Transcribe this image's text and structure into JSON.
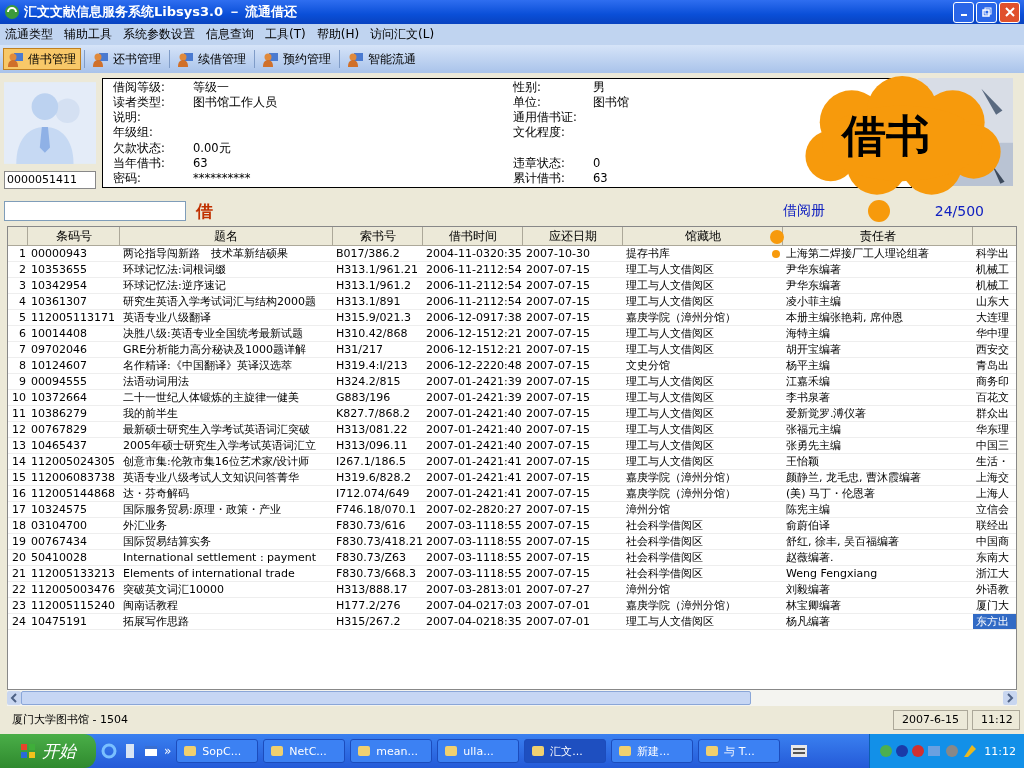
{
  "window": {
    "title": "汇文文献信息服务系统Libsys3.0 － 流通借还"
  },
  "menu": [
    "流通类型",
    "辅助工具",
    "系统参数设置",
    "信息查询",
    "工具(T)",
    "帮助(H)",
    "访问汇文(L)"
  ],
  "toolbar": {
    "items": [
      {
        "label": "借书管理",
        "selected": true
      },
      {
        "label": "还书管理",
        "selected": false
      },
      {
        "label": "续借管理",
        "selected": false
      },
      {
        "label": "预约管理",
        "selected": false
      },
      {
        "label": "智能流通",
        "selected": false
      }
    ]
  },
  "reader": {
    "card_number": "0000051411",
    "left_fields": [
      {
        "label": "借阅等级:",
        "value": "等级一"
      },
      {
        "label": "读者类型:",
        "value": "图书馆工作人员"
      },
      {
        "label": "说明:"
      },
      {
        "label": "年级组:"
      },
      {
        "label": "欠款状态:",
        "value": "0.00元"
      },
      {
        "label": "当年借书:",
        "value": "63"
      },
      {
        "label": "密码:",
        "value": "**********"
      }
    ],
    "right_fields": [
      {
        "label": "性别:",
        "value": "男"
      },
      {
        "label": "单位:",
        "value": "图书馆"
      },
      {
        "label": "通用借书证:"
      },
      {
        "label": "文化程度:"
      },
      {
        "label": "违章状态:",
        "value": "0"
      },
      {
        "label": "累计借书:",
        "value": "63"
      }
    ]
  },
  "borrow_bar": {
    "mode_mark": "借",
    "count_label": "借阅册",
    "count_value": "24/500"
  },
  "callout": {
    "text": "借书"
  },
  "table": {
    "columns": [
      "条码号",
      "题名",
      "索书号",
      "借书时间",
      "应还日期",
      "馆藏地",
      "责任者"
    ],
    "rows": [
      {
        "no": "1",
        "barcode": "00000943",
        "title": "两论指导闯新路　技术革新结硕果",
        "call_no": "B017/386.2",
        "borrowed": "2004-11-0320:35",
        "due": "2007-10-30",
        "location": "提存书库",
        "author": "上海第二焊接厂工人理论组著",
        "publisher": "科学出",
        "selected": false
      },
      {
        "no": "2",
        "barcode": "10353655",
        "title": "环球记忆法:词根词缀",
        "call_no": "H313.1/961.21",
        "borrowed": "2006-11-2112:54",
        "due": "2007-07-15",
        "location": "理工与人文借阅区",
        "author": "尹华东编著",
        "publisher": "机械工",
        "selected": false
      },
      {
        "no": "3",
        "barcode": "10342954",
        "title": "环球记忆法:逆序速记",
        "call_no": "H313.1/961.2",
        "borrowed": "2006-11-2112:54",
        "due": "2007-07-15",
        "location": "理工与人文借阅区",
        "author": "尹华东编著",
        "publisher": "机械工",
        "selected": false
      },
      {
        "no": "4",
        "barcode": "10361307",
        "title": "研究生英语入学考试词汇与结构2000题",
        "call_no": "H313.1/891",
        "borrowed": "2006-11-2112:54",
        "due": "2007-07-15",
        "location": "理工与人文借阅区",
        "author": "凌小菲主编",
        "publisher": "山东大",
        "selected": false
      },
      {
        "no": "5",
        "barcode": "112005113171",
        "title": "英语专业八级翻译",
        "call_no": "H315.9/021.3",
        "borrowed": "2006-12-0917:38",
        "due": "2007-07-15",
        "location": "嘉庚学院（漳州分馆）",
        "author": "本册主编张艳莉, 席仲恩",
        "publisher": "大连理",
        "selected": false
      },
      {
        "no": "6",
        "barcode": "10014408",
        "title": "决胜八级:英语专业全国统考最新试题",
        "call_no": "H310.42/868",
        "borrowed": "2006-12-1512:21",
        "due": "2007-07-15",
        "location": "理工与人文借阅区",
        "author": "海特主编",
        "publisher": "华中理",
        "selected": false
      },
      {
        "no": "7",
        "barcode": "09702046",
        "title": "GRE分析能力高分秘诀及1000题详解",
        "call_no": "H31/217",
        "borrowed": "2006-12-1512:21",
        "due": "2007-07-15",
        "location": "理工与人文借阅区",
        "author": "胡开宝编著",
        "publisher": "西安交",
        "selected": false
      },
      {
        "no": "8",
        "barcode": "10124607",
        "title": "名作精译:《中国翻译》英译汉选萃",
        "call_no": "H319.4:I/213",
        "borrowed": "2006-12-2220:48",
        "due": "2007-07-15",
        "location": "文史分馆",
        "author": "杨平主编",
        "publisher": "青岛出",
        "selected": false
      },
      {
        "no": "9",
        "barcode": "00094555",
        "title": "法语动词用法",
        "call_no": "H324.2/815",
        "borrowed": "2007-01-2421:39",
        "due": "2007-07-15",
        "location": "理工与人文借阅区",
        "author": "江嘉禾编",
        "publisher": "商务印",
        "selected": false
      },
      {
        "no": "10",
        "barcode": "10372664",
        "title": "二十一世纪人体锻炼的主旋律一健美",
        "call_no": "G883/196",
        "borrowed": "2007-01-2421:39",
        "due": "2007-07-15",
        "location": "理工与人文借阅区",
        "author": "李书泉著",
        "publisher": "百花文",
        "selected": false
      },
      {
        "no": "11",
        "barcode": "10386279",
        "title": "我的前半生",
        "call_no": "K827.7/868.2",
        "borrowed": "2007-01-2421:40",
        "due": "2007-07-15",
        "location": "理工与人文借阅区",
        "author": "爱新觉罗.溥仪著",
        "publisher": "群众出",
        "selected": false
      },
      {
        "no": "12",
        "barcode": "00767829",
        "title": "最新硕士研究生入学考试英语词汇突破",
        "call_no": "H313/081.22",
        "borrowed": "2007-01-2421:40",
        "due": "2007-07-15",
        "location": "理工与人文借阅区",
        "author": "张福元主编",
        "publisher": "华东理",
        "selected": false
      },
      {
        "no": "13",
        "barcode": "10465437",
        "title": "2005年硕士研究生入学考试英语词汇立",
        "call_no": "H313/096.11",
        "borrowed": "2007-01-2421:40",
        "due": "2007-07-15",
        "location": "理工与人文借阅区",
        "author": "张勇先主编",
        "publisher": "中国三",
        "selected": false
      },
      {
        "no": "14",
        "barcode": "112005024305",
        "title": "创意市集:伦敦市集16位艺术家/设计师",
        "call_no": "I267.1/186.5",
        "borrowed": "2007-01-2421:41",
        "due": "2007-07-15",
        "location": "理工与人文借阅区",
        "author": "王怡颖",
        "publisher": "生活・",
        "selected": false
      },
      {
        "no": "15",
        "barcode": "112006083738",
        "title": "英语专业八级考试人文知识问答菁华",
        "call_no": "H319.6/828.2",
        "borrowed": "2007-01-2421:41",
        "due": "2007-07-15",
        "location": "嘉庚学院（漳州分馆）",
        "author": "颜静兰, 龙毛忠, 曹沐霞编著",
        "publisher": "上海交",
        "selected": false
      },
      {
        "no": "16",
        "barcode": "112005144868",
        "title": "达・芬奇解码",
        "call_no": "I712.074/649",
        "borrowed": "2007-01-2421:41",
        "due": "2007-07-15",
        "location": "嘉庚学院（漳州分馆）",
        "author": "(美) 马丁・伦恩著",
        "publisher": "上海人",
        "selected": false
      },
      {
        "no": "17",
        "barcode": "10324575",
        "title": "国际服务贸易:原理・政策・产业",
        "call_no": "F746.18/070.1",
        "borrowed": "2007-02-2820:27",
        "due": "2007-07-15",
        "location": "漳州分馆",
        "author": "陈宪主编",
        "publisher": "立信会",
        "selected": false
      },
      {
        "no": "18",
        "barcode": "03104700",
        "title": "外汇业务",
        "call_no": "F830.73/616",
        "borrowed": "2007-03-1118:55",
        "due": "2007-07-15",
        "location": "社会科学借阅区",
        "author": "俞蔚伯译",
        "publisher": "联经出",
        "selected": false
      },
      {
        "no": "19",
        "barcode": "00767434",
        "title": "国际贸易结算实务",
        "call_no": "F830.73/418.21",
        "borrowed": "2007-03-1118:55",
        "due": "2007-07-15",
        "location": "社会科学借阅区",
        "author": "舒红, 徐丰, 吴百福编著",
        "publisher": "中国商",
        "selected": false
      },
      {
        "no": "20",
        "barcode": "50410028",
        "title": "International settlement : payment",
        "call_no": "F830.73/Z63",
        "borrowed": "2007-03-1118:55",
        "due": "2007-07-15",
        "location": "社会科学借阅区",
        "author": "赵薇编著.",
        "publisher": "东南大",
        "selected": false
      },
      {
        "no": "21",
        "barcode": "112005133213",
        "title": "Elements of international trade",
        "call_no": "F830.73/668.3",
        "borrowed": "2007-03-1118:55",
        "due": "2007-07-15",
        "location": "社会科学借阅区",
        "author": "Weng Fengxiang",
        "publisher": "浙江大",
        "selected": false
      },
      {
        "no": "22",
        "barcode": "112005003476",
        "title": "突破英文词汇10000",
        "call_no": "H313/888.17",
        "borrowed": "2007-03-2813:01",
        "due": "2007-07-27",
        "location": "漳州分馆",
        "author": "刘毅编著",
        "publisher": "外语教",
        "selected": false
      },
      {
        "no": "23",
        "barcode": "112005115240",
        "title": "闽南话教程",
        "call_no": "H177.2/276",
        "borrowed": "2007-04-0217:03",
        "due": "2007-07-01",
        "location": "嘉庚学院（漳州分馆）",
        "author": "林宝卿编著",
        "publisher": "厦门大",
        "selected": false
      },
      {
        "no": "24",
        "barcode": "10475191",
        "title": "拓展写作思路",
        "call_no": "H315/267.2",
        "borrowed": "2007-04-0218:35",
        "due": "2007-07-01",
        "location": "理工与人文借阅区",
        "author": "杨凡编著",
        "publisher": "东方出",
        "selected": true
      }
    ]
  },
  "status_bar": {
    "library": "厦门大学图书馆 - 1504",
    "date": "2007-6-15",
    "time": "11:12"
  },
  "taskbar": {
    "start": "开始",
    "overflow": "»",
    "tasks": [
      {
        "label": "SopC...",
        "selected": false
      },
      {
        "label": "NetC...",
        "selected": false
      },
      {
        "label": "mean...",
        "selected": false
      },
      {
        "label": "ulla...",
        "selected": false
      },
      {
        "label": "汇文...",
        "selected": true
      },
      {
        "label": "新建...",
        "selected": false
      },
      {
        "label": "与 T...",
        "selected": false
      }
    ],
    "clock": "11:12"
  }
}
